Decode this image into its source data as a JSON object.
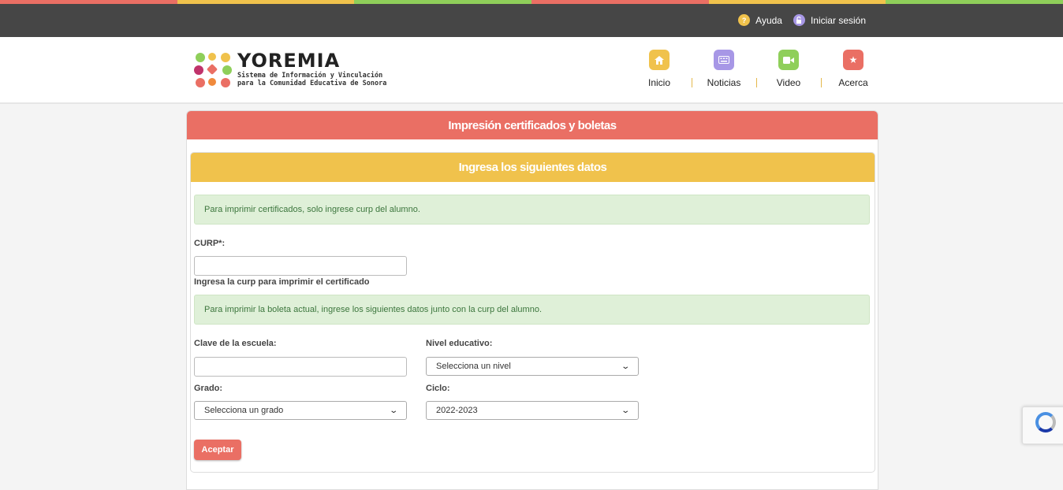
{
  "topbar": {
    "stripe_colors": [
      "#ea6f64",
      "#f0c24c",
      "#8fcf5a",
      "#ea6f64",
      "#f0c24c",
      "#8fcf5a"
    ],
    "help_label": "Ayuda",
    "help_icon": "question-icon",
    "login_label": "Iniciar sesión",
    "login_icon": "lock-icon"
  },
  "logo": {
    "title": "YOREMIA",
    "subtitle_line1": "Sistema de Información y Vinculación",
    "subtitle_line2": "para la Comunidad Educativa de Sonora"
  },
  "nav": [
    {
      "label": "Inicio",
      "icon": "home-icon",
      "color": "#f0c24c"
    },
    {
      "label": "Noticias",
      "icon": "keyboard-icon",
      "color": "#a797e6"
    },
    {
      "label": "Video",
      "icon": "video-camera-icon",
      "color": "#8fcf5a"
    },
    {
      "label": "Acerca",
      "icon": "star-icon",
      "color": "#ea6f64"
    }
  ],
  "card": {
    "title": "Impresión certificados y boletas",
    "subtitle": "Ingresa los siguientes datos",
    "alert1": "Para imprimir certificados, solo ingrese curp del alumno.",
    "curp_label": "CURP*:",
    "curp_value": "",
    "curp_help": "Ingresa la curp para imprimir el certificado",
    "alert2": "Para imprimir la boleta actual, ingrese los siguientes datos junto con la curp del alumno.",
    "clave_label": "Clave de la escuela:",
    "clave_value": "",
    "nivel_label": "Nivel educativo:",
    "nivel_value": "Selecciona un nivel",
    "grado_label": "Grado:",
    "grado_value": "Selecciona un grado",
    "ciclo_label": "Ciclo:",
    "ciclo_value": "2022-2023",
    "accept_label": "Aceptar"
  },
  "colors": {
    "header_red": "#ea6f64",
    "header_yellow": "#f0c24c",
    "alert_green": "#dff0d8"
  }
}
